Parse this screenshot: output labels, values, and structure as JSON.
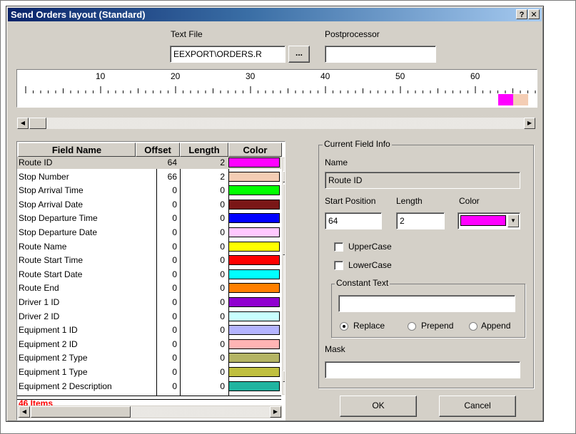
{
  "window": {
    "title": "Send Orders layout (Standard)",
    "help_button": "?",
    "close_button": "✕"
  },
  "text_file": {
    "label": "Text File",
    "value": "EEXPORT\\ORDERS.R",
    "browse_label": "..."
  },
  "postprocessor": {
    "label": "Postprocessor",
    "value": ""
  },
  "ruler": {
    "marks": [
      "10",
      "20",
      "30",
      "40",
      "50",
      "60"
    ],
    "highlights": [
      {
        "name": "Route ID",
        "start": 64,
        "length": 2,
        "color": "#ff00ff"
      },
      {
        "name": "Stop Number",
        "start": 66,
        "length": 2,
        "color": "#f4cdb4"
      }
    ]
  },
  "grid": {
    "columns": [
      "Field Name",
      "Offset",
      "Length",
      "Color"
    ],
    "rows": [
      {
        "name": "Route ID",
        "offset": "64",
        "length": "2",
        "color": "#ff00ff",
        "selected": true
      },
      {
        "name": "Stop Number",
        "offset": "66",
        "length": "2",
        "color": "#f4cdb4"
      },
      {
        "name": "Stop Arrival Time",
        "offset": "0",
        "length": "0",
        "color": "#00ff00"
      },
      {
        "name": "Stop Arrival Date",
        "offset": "0",
        "length": "0",
        "color": "#7a1616"
      },
      {
        "name": "Stop Departure Time",
        "offset": "0",
        "length": "0",
        "color": "#0000ff"
      },
      {
        "name": "Stop Departure Date",
        "offset": "0",
        "length": "0",
        "color": "#ffc8ff"
      },
      {
        "name": "Route Name",
        "offset": "0",
        "length": "0",
        "color": "#ffff00"
      },
      {
        "name": "Route Start Time",
        "offset": "0",
        "length": "0",
        "color": "#ff0000"
      },
      {
        "name": "Route Start Date",
        "offset": "0",
        "length": "0",
        "color": "#00ffff"
      },
      {
        "name": "Route End",
        "offset": "0",
        "length": "0",
        "color": "#ff8000"
      },
      {
        "name": "Driver 1 ID",
        "offset": "0",
        "length": "0",
        "color": "#9000d0"
      },
      {
        "name": "Driver 2 ID",
        "offset": "0",
        "length": "0",
        "color": "#c8ffff"
      },
      {
        "name": "Equipment 1 ID",
        "offset": "0",
        "length": "0",
        "color": "#b4b4ff"
      },
      {
        "name": "Equipment 2 ID",
        "offset": "0",
        "length": "0",
        "color": "#ffb4b4"
      },
      {
        "name": "Equipment 2 Type",
        "offset": "0",
        "length": "0",
        "color": "#b4b464"
      },
      {
        "name": "Equipment 1 Type",
        "offset": "0",
        "length": "0",
        "color": "#c0c040"
      },
      {
        "name": "Equipment 2 Description",
        "offset": "0",
        "length": "0",
        "color": "#20b4a0"
      }
    ],
    "item_count": "46 Items"
  },
  "current_field": {
    "group_label": "Current Field Info",
    "name_label": "Name",
    "name_value": "Route ID",
    "start_label": "Start Position",
    "start_value": "64",
    "length_label": "Length",
    "length_value": "2",
    "color_label": "Color",
    "color_value": "#ff00ff",
    "uppercase_label": "UpperCase",
    "lowercase_label": "LowerCase",
    "constant_label": "Constant Text",
    "constant_value": "",
    "mode_options": [
      "Replace",
      "Prepend",
      "Append"
    ],
    "mode_selected": "Replace",
    "mask_label": "Mask",
    "mask_value": ""
  },
  "buttons": {
    "ok": "OK",
    "cancel": "Cancel"
  }
}
